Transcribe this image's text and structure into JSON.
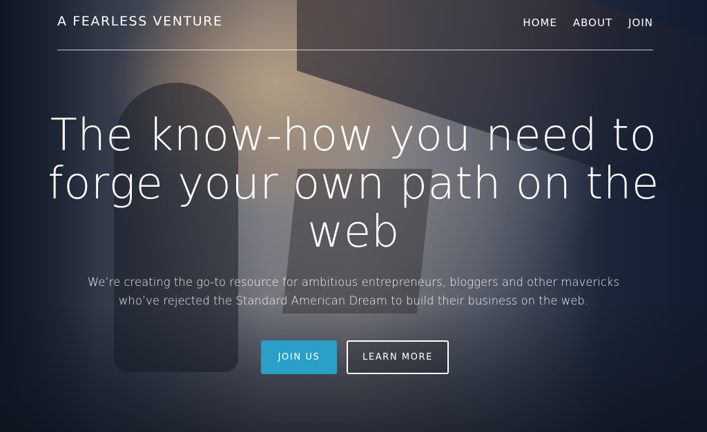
{
  "nav": {
    "brand": "A FEARLESS VENTURE",
    "items": [
      {
        "label": "HOME"
      },
      {
        "label": "ABOUT"
      },
      {
        "label": "JOIN"
      }
    ]
  },
  "hero": {
    "headline": "The know-how you need to forge your own path on the web",
    "subheadline": "We’re creating the go-to resource for ambitious entrepreneurs, bloggers and other mavericks who’ve rejected the Standard American Dream to build their business on the web.",
    "primary_button": "JOIN US",
    "secondary_button": "LEARN MORE"
  },
  "colors": {
    "accent": "#2a9fc8",
    "text": "#ffffff"
  }
}
